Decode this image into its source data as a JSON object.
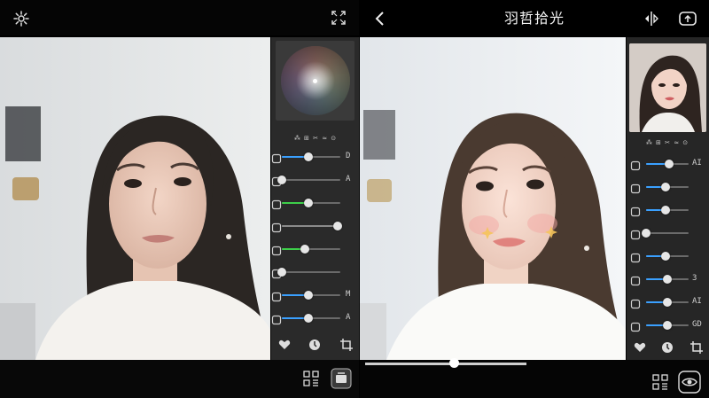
{
  "app": {
    "title": "羽哲拾光"
  },
  "left_panel": {
    "color_wheel_name": "color-wheel",
    "tool_strip": "⁂ ⊞ ✂ ≈ ⊙",
    "sliders": [
      {
        "tag": "D",
        "value": 0.45,
        "color": "#3aa0ff"
      },
      {
        "tag": "A",
        "value": 0.0,
        "color": "#a04be0"
      },
      {
        "tag": "",
        "value": 0.45,
        "color": "#3dcf4a"
      },
      {
        "tag": "",
        "value": 0.95,
        "color": "#8a8a8a"
      },
      {
        "tag": "",
        "value": 0.4,
        "color": "#3dcf4a"
      },
      {
        "tag": "",
        "value": 0.0,
        "color": "#6a6a6a"
      },
      {
        "tag": "M",
        "value": 0.45,
        "color": "#3aa0ff"
      },
      {
        "tag": "A",
        "value": 0.45,
        "color": "#3aa0ff"
      }
    ]
  },
  "right_panel": {
    "tool_strip": "⁂ ⊞ ✂ ≈ ⊙",
    "sliders": [
      {
        "tag": "AI",
        "value": 0.55
      },
      {
        "tag": "",
        "value": 0.45
      },
      {
        "tag": "",
        "value": 0.45
      },
      {
        "tag": "",
        "value": 0.0
      },
      {
        "tag": "",
        "value": 0.45
      },
      {
        "tag": "3",
        "value": 0.5
      },
      {
        "tag": "AI",
        "value": 0.5
      },
      {
        "tag": "GD",
        "value": 0.5
      }
    ]
  },
  "compare": {
    "value": 0.55
  },
  "colors": {
    "accent": "#3aa0ff",
    "panel_left": "#2a2a2a",
    "panel_right": "#262626"
  }
}
